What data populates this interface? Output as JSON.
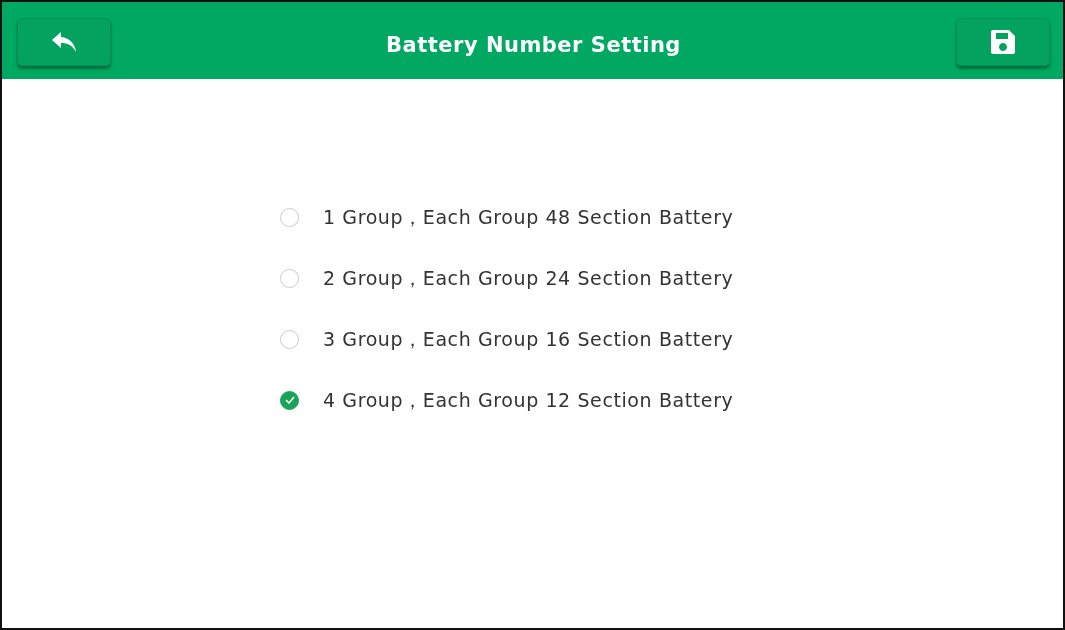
{
  "header": {
    "title": "Battery Number Setting"
  },
  "options": [
    {
      "label": "1 Group，Each Group 48 Section Battery",
      "selected": false
    },
    {
      "label": "2 Group，Each Group 24 Section Battery",
      "selected": false
    },
    {
      "label": "3 Group，Each Group 16 Section Battery",
      "selected": false
    },
    {
      "label": "4 Group，Each Group 12 Section Battery",
      "selected": true
    }
  ]
}
